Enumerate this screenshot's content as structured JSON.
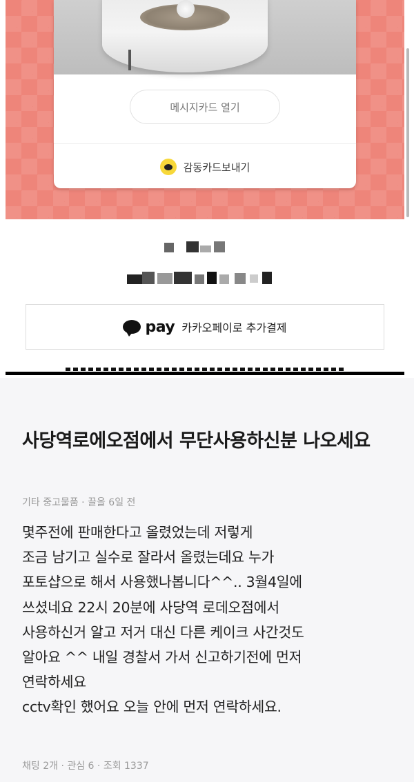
{
  "gift_card": {
    "message_card_button": "메시지카드 열기",
    "send_card_button": "감동카드보내기"
  },
  "payment": {
    "pay_logo": "pay",
    "pay_label": "카카오페이로 추가결제"
  },
  "post": {
    "title": "사당역로에오점에서 무단사용하신분 나오세요",
    "meta": "기타 중고물품 · 끌올 6일 전",
    "body": "몇주전에 판매한다고 올렸었는데 저렇게\n조금 남기고 실수로 잘라서 올렸는데요 누가\n포토샵으로 해서 사용했나봅니다^^.. 3월4일에\n쓰셨네요 22시 20분에 사당역 로데오점에서\n사용하신거 알고 저거 대신 다른 케이크 사간것도\n알아요 ^^ 내일 경찰서 가서 신고하기전에 먼저\n연락하세요\ncctv확인 했어요 오늘 안에 먼저 연락하세요.",
    "stats": "채팅 2개 · 관심 6 · 조회 1337"
  },
  "colors": {
    "gift_background": "#ee857a",
    "kakao_yellow": "#f7d83a",
    "post_background": "#f6f6f8"
  }
}
